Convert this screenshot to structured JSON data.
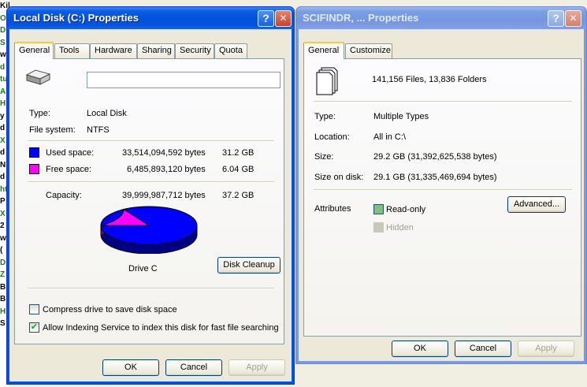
{
  "background": {
    "fragments": [
      "Kilbourne",
      "O",
      "D",
      "S",
      "w",
      "d",
      "tu",
      "Al",
      "Hi",
      "y",
      "d",
      "X",
      "d",
      "N",
      "d",
      "ht",
      "P",
      "X",
      "2",
      "w",
      "(",
      "D",
      "Z",
      "B",
      "B",
      "H",
      "S"
    ]
  },
  "left_window": {
    "title": "Local Disk (C:) Properties",
    "help_symbol": "?",
    "close_symbol": "✕",
    "tabs": [
      "General",
      "Tools",
      "Hardware",
      "Sharing",
      "Security",
      "Quota"
    ],
    "label_value": "",
    "type_label": "Type:",
    "type_value": "Local Disk",
    "fs_label": "File system:",
    "fs_value": "NTFS",
    "used_label": "Used space:",
    "used_bytes": "33,514,094,592 bytes",
    "used_gb": "31.2 GB",
    "free_label": "Free space:",
    "free_bytes": "6,485,893,120 bytes",
    "free_gb": "6.04 GB",
    "capacity_label": "Capacity:",
    "capacity_bytes": "39,999,987,712 bytes",
    "capacity_gb": "37.2 GB",
    "drive_label": "Drive C",
    "disk_cleanup": "Disk Cleanup",
    "compress_label": "Compress drive to save disk space",
    "compress_checked": false,
    "index_label": "Allow Indexing Service to index this disk for fast file searching",
    "index_checked": true,
    "ok": "OK",
    "cancel": "Cancel",
    "apply": "Apply",
    "colors": {
      "used": "#0000ff",
      "free": "#ff00ff"
    },
    "usage": {
      "used_fraction": 0.838
    }
  },
  "right_window": {
    "title": "SCIFINDR, ... Properties",
    "help_symbol": "?",
    "close_symbol": "✕",
    "tabs": [
      "General",
      "Customize"
    ],
    "summary": "141,156 Files, 13,836 Folders",
    "type_label": "Type:",
    "type_value": "Multiple Types",
    "location_label": "Location:",
    "location_value": "All in C:\\",
    "size_label": "Size:",
    "size_value": "29.2 GB (31,392,625,538 bytes)",
    "sod_label": "Size on disk:",
    "sod_value": "29.1 GB (31,335,469,694 bytes)",
    "attributes_label": "Attributes",
    "readonly_label": "Read-only",
    "hidden_label": "Hidden",
    "advanced": "Advanced...",
    "ok": "OK",
    "cancel": "Cancel",
    "apply": "Apply"
  }
}
